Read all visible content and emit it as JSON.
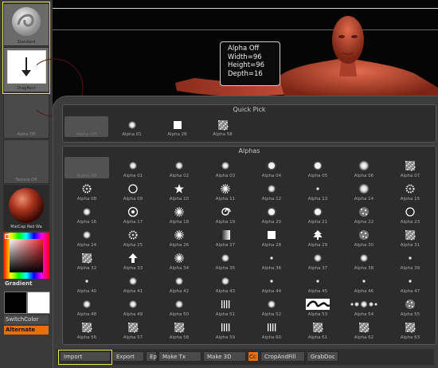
{
  "left_tray": {
    "standard_label": "Standard",
    "dragrect_label": "DragRect",
    "alpha_off_label": "Alpha Off",
    "texture_off_label": "Texture Off",
    "matcap_label": "MatCap Red Wa",
    "gradient_label": "Gradient",
    "switchcolor_label": "SwitchColor",
    "alternate_label": "Alternate"
  },
  "tooltip": {
    "title": "Alpha Off",
    "width": "Width=96",
    "height": "Height=96",
    "depth": "Depth=16"
  },
  "quick_pick": {
    "title": "Quick Pick",
    "items": [
      {
        "label": "Alpha Off",
        "icon": "empty"
      },
      {
        "label": "Alpha 01",
        "icon": "soft"
      },
      {
        "label": "Alpha 28",
        "icon": "square"
      },
      {
        "label": "Alpha 58",
        "icon": "noise"
      }
    ]
  },
  "alphas": {
    "title": "Alphas",
    "items": [
      {
        "label": "Alpha Off",
        "icon": "empty"
      },
      {
        "label": "Alpha 01",
        "icon": "soft"
      },
      {
        "label": "Alpha 02",
        "icon": "soft"
      },
      {
        "label": "Alpha 03",
        "icon": "soft"
      },
      {
        "label": "Alpha 04",
        "icon": "spot"
      },
      {
        "label": "Alpha 05",
        "icon": "spot"
      },
      {
        "label": "Alpha 06",
        "icon": "bigsoft"
      },
      {
        "label": "Alpha 07",
        "icon": "noise"
      },
      {
        "label": "Alpha 08",
        "icon": "gear"
      },
      {
        "label": "Alpha 09",
        "icon": "ring"
      },
      {
        "label": "Alpha 10",
        "icon": "star"
      },
      {
        "label": "Alpha 11",
        "icon": "burst"
      },
      {
        "label": "Alpha 12",
        "icon": "soft"
      },
      {
        "label": "Alpha 13",
        "icon": "dot"
      },
      {
        "label": "Alpha 14",
        "icon": "bigsoft"
      },
      {
        "label": "Alpha 15",
        "icon": "gear"
      },
      {
        "label": "Alpha 16",
        "icon": "soft"
      },
      {
        "label": "Alpha 17",
        "icon": "target"
      },
      {
        "label": "Alpha 18",
        "icon": "burst"
      },
      {
        "label": "Alpha 19",
        "icon": "swirl"
      },
      {
        "label": "Alpha 20",
        "icon": "spot"
      },
      {
        "label": "Alpha 21",
        "icon": "spot"
      },
      {
        "label": "Alpha 22",
        "icon": "dots"
      },
      {
        "label": "Alpha 23",
        "icon": "ring"
      },
      {
        "label": "Alpha 24",
        "icon": "soft"
      },
      {
        "label": "Alpha 25",
        "icon": "gear"
      },
      {
        "label": "Alpha 26",
        "icon": "burst"
      },
      {
        "label": "Alpha 27",
        "icon": "gradient"
      },
      {
        "label": "Alpha 28",
        "icon": "square"
      },
      {
        "label": "Alpha 29",
        "icon": "tree"
      },
      {
        "label": "Alpha 30",
        "icon": "dots"
      },
      {
        "label": "Alpha 31",
        "icon": "noise"
      },
      {
        "label": "Alpha 32",
        "icon": "noise"
      },
      {
        "label": "Alpha 33",
        "icon": "arrow"
      },
      {
        "label": "Alpha 34",
        "icon": "burst"
      },
      {
        "label": "Alpha 35",
        "icon": "soft"
      },
      {
        "label": "Alpha 36",
        "icon": "dot"
      },
      {
        "label": "Alpha 37",
        "icon": "soft"
      },
      {
        "label": "Alpha 38",
        "icon": "soft"
      },
      {
        "label": "Alpha 39",
        "icon": "dot"
      },
      {
        "label": "Alpha 40",
        "icon": "dot"
      },
      {
        "label": "Alpha 41",
        "icon": "soft"
      },
      {
        "label": "Alpha 42",
        "icon": "soft"
      },
      {
        "label": "Alpha 43",
        "icon": "soft"
      },
      {
        "label": "Alpha 44",
        "icon": "dot"
      },
      {
        "label": "Alpha 45",
        "icon": "dot"
      },
      {
        "label": "Alpha 46",
        "icon": "dot"
      },
      {
        "label": "Alpha 47",
        "icon": "dot"
      },
      {
        "label": "Alpha 48",
        "icon": "soft"
      },
      {
        "label": "Alpha 49",
        "icon": "soft"
      },
      {
        "label": "Alpha 50",
        "icon": "soft"
      },
      {
        "label": "Alpha 51",
        "icon": "stripes"
      },
      {
        "label": "Alpha 52",
        "icon": "soft"
      },
      {
        "label": "Alpha 53",
        "icon": "pattern"
      },
      {
        "label": "Alpha 54",
        "icon": "row"
      },
      {
        "label": "Alpha 55",
        "icon": "dots"
      },
      {
        "label": "Alpha 56",
        "icon": "noise"
      },
      {
        "label": "Alpha 57",
        "icon": "noise"
      },
      {
        "label": "Alpha 58",
        "icon": "noise"
      },
      {
        "label": "Alpha 59",
        "icon": "stripes"
      },
      {
        "label": "Alpha 60",
        "icon": "stripes"
      },
      {
        "label": "Alpha 61",
        "icon": "noise"
      },
      {
        "label": "Alpha 62",
        "icon": "noise"
      },
      {
        "label": "Alpha 63",
        "icon": "noise"
      }
    ]
  },
  "bottom_bar": {
    "import": "Import",
    "export": "Export",
    "ep": "Ep",
    "make_tx": "Make Tx",
    "make_3d": "Make 3D",
    "cc": "Cc",
    "crop_and_fill": "CropAndFill",
    "grab_doc": "GrabDoc"
  },
  "colors": {
    "highlight": "#e8ec4c",
    "accent": "#e8700a",
    "skin": "#c04a34"
  }
}
